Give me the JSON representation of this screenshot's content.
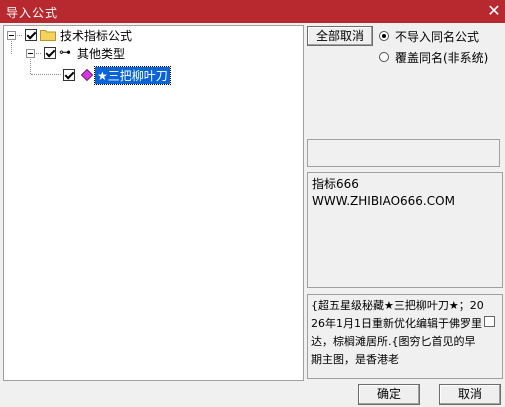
{
  "window": {
    "title": "导入公式",
    "close_glyph": "✕"
  },
  "tree": {
    "root": {
      "label": "技术指标公式"
    },
    "child": {
      "label": "其他类型",
      "icon_glyph": "⊶"
    },
    "leaf": {
      "label": "★三把柳叶刀"
    }
  },
  "options": {
    "cancel_all_label": "全部取消",
    "radio_1_label": "不导入同名公式",
    "radio_2_label": "覆盖同名(非系统)"
  },
  "info": {
    "line_1": "指标666",
    "line_2": "WWW.ZHIBIAO666.COM"
  },
  "description": {
    "text": "{超五星级秘藏★三把柳叶刀★；2026年1月1日重新优化编辑于佛罗里达，棕榈滩居所.{图穷匕首见的早期主图，是香港老"
  },
  "buttons": {
    "ok_label": "确定",
    "cancel_label": "取消"
  },
  "colors": {
    "titlebar": "#b8292f",
    "selection": "#0a64d8",
    "folder": "#f3d35d"
  }
}
